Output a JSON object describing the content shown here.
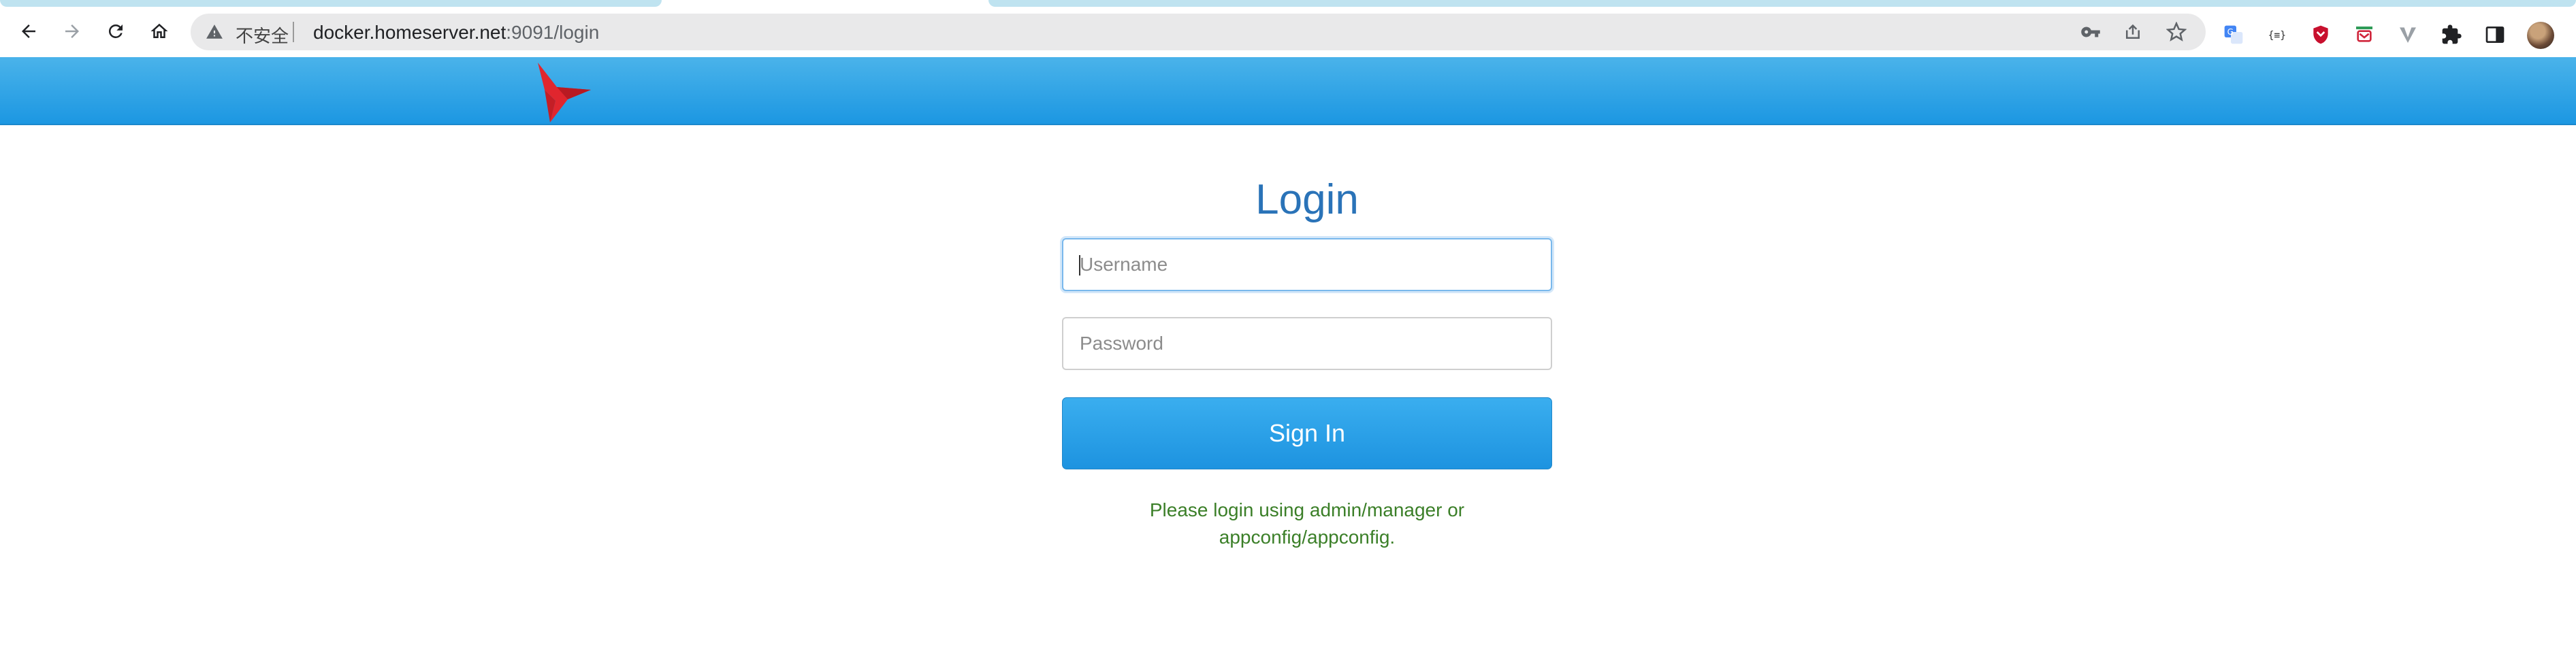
{
  "browser": {
    "security_label": "不安全",
    "url_host": "docker.homeserver.net",
    "url_rest": ":9091/login",
    "icons": {
      "back": "arrow-left-icon",
      "forward": "arrow-right-icon",
      "reload": "reload-icon",
      "home": "home-icon",
      "warning": "warning-triangle-icon",
      "key": "key-icon",
      "share": "share-icon",
      "bookmark": "star-icon"
    },
    "extensions": [
      "translate-icon",
      "json-viewer-icon",
      "shield-icon",
      "mail-icon",
      "v-extension-icon",
      "puzzle-icon",
      "side-panel-icon"
    ]
  },
  "header": {
    "logo": "red-bird-logo",
    "background": "#2aa3e8"
  },
  "login": {
    "title": "Login",
    "username_placeholder": "Username",
    "username_value": "",
    "password_placeholder": "Password",
    "password_value": "",
    "submit_label": "Sign In",
    "hint": "Please login using admin/manager or appconfig/appconfig."
  },
  "colors": {
    "title": "#2a73b8",
    "button": "#2196e3",
    "hint": "#3b7f28",
    "logo": "#e0262e"
  }
}
